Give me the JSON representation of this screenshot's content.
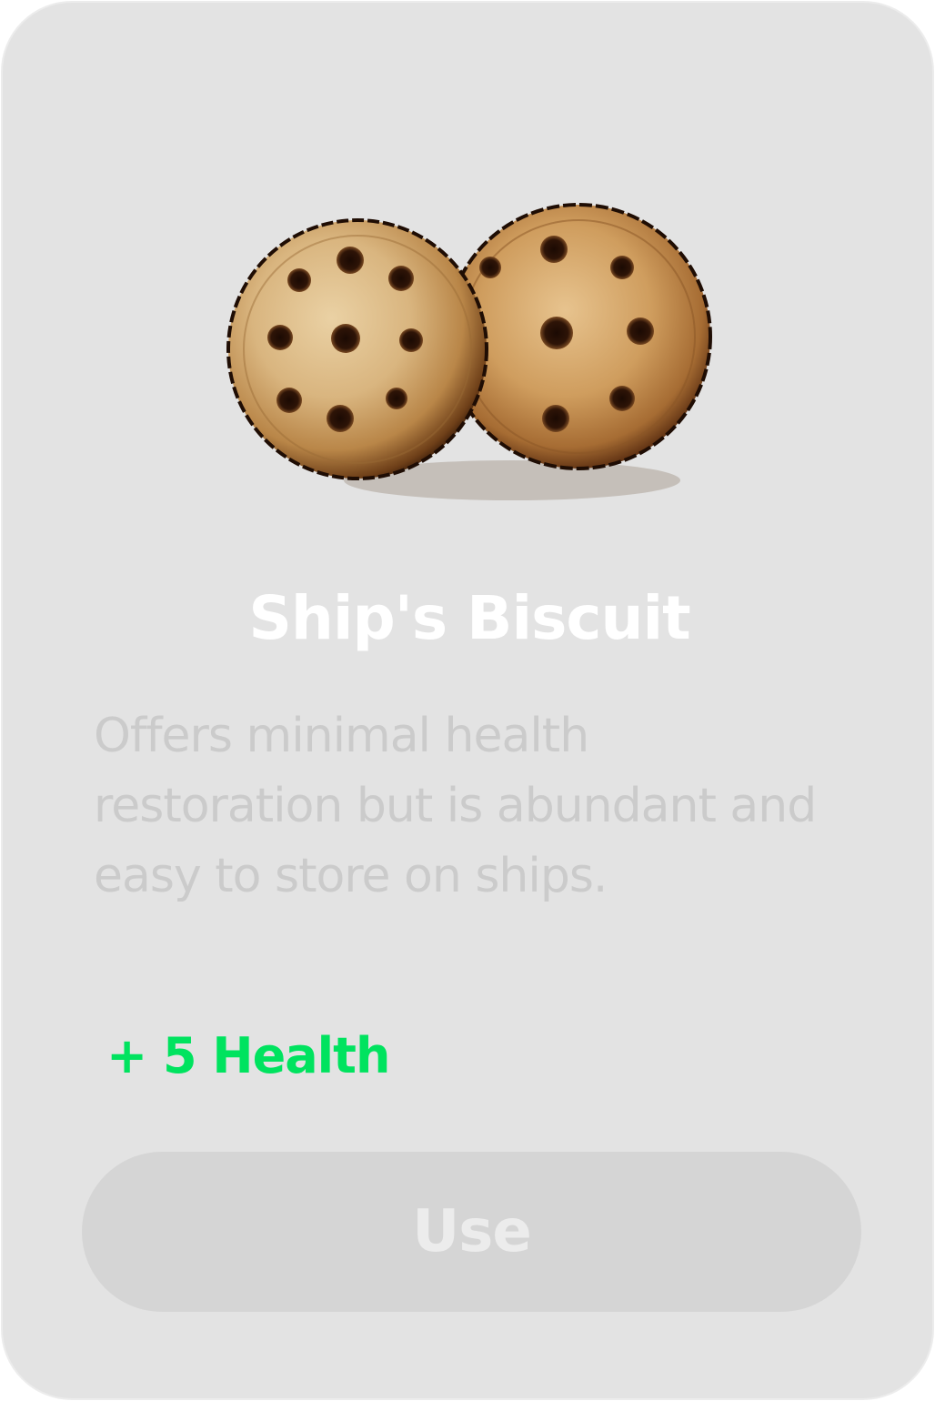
{
  "item": {
    "image_icon": "ships-biscuit-icon",
    "name": "Ship's Biscuit",
    "description": "Offers minimal health restoration but is abundant and easy to store on ships.",
    "effect": "+ 5 Health"
  },
  "actions": {
    "use_label": "Use"
  },
  "colors": {
    "card_background": "#e3e3e3",
    "title": "#ffffff",
    "description": "#cbcbcb",
    "effect": "#00e35f",
    "button_background": "#d5d5d5",
    "button_text": "#ececec"
  }
}
